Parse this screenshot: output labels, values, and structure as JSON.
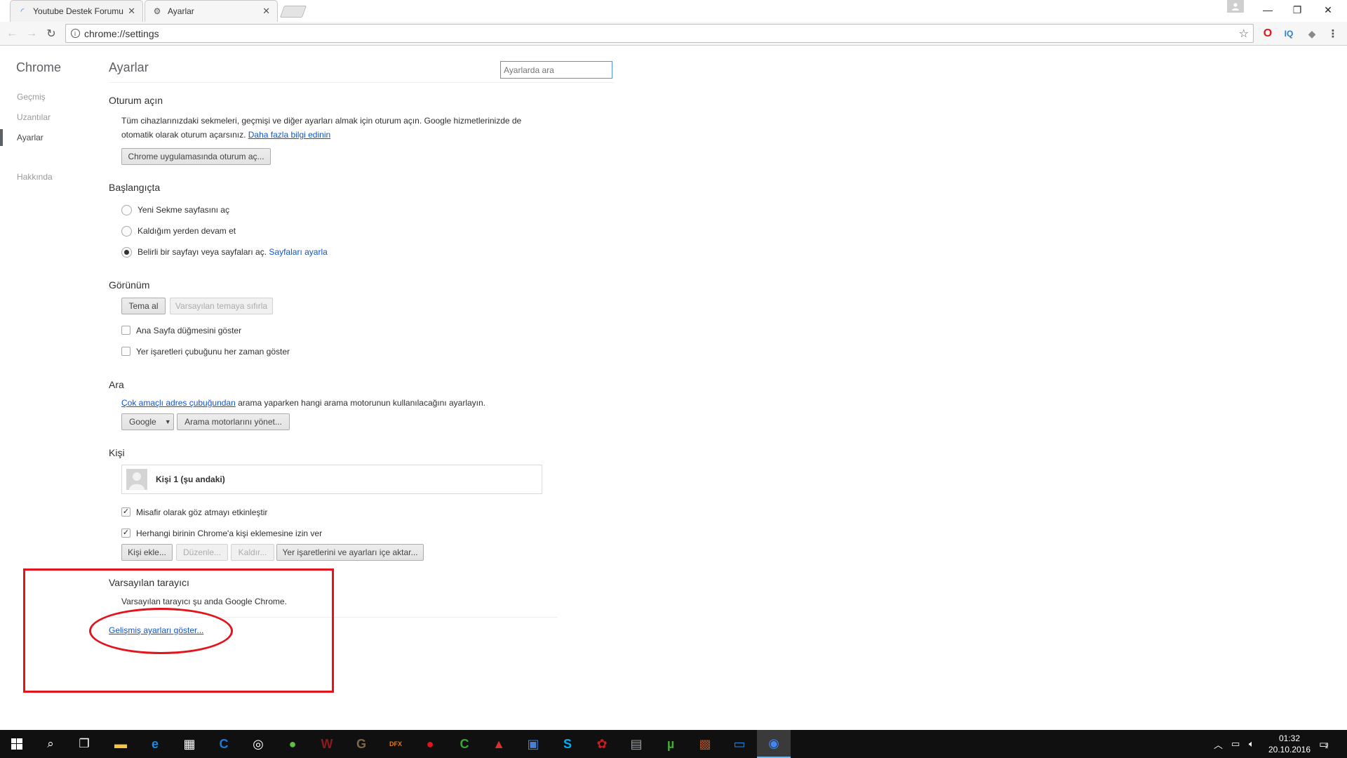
{
  "browser": {
    "tabs": [
      {
        "title": "Youtube Destek Forumu",
        "favicon": "loading-spinner-icon"
      },
      {
        "title": "Ayarlar",
        "favicon": "gear-icon"
      }
    ],
    "url": "chrome://settings",
    "extensions": [
      {
        "name": "opera-icon",
        "glyph": "O",
        "color": "#e0161b"
      },
      {
        "name": "iq-icon",
        "glyph": "IQ",
        "color": "#2a7fd4"
      },
      {
        "name": "shield-extension-icon",
        "glyph": "◆",
        "color": "#8a8a8a"
      }
    ]
  },
  "sidebar": {
    "title": "Chrome",
    "items": [
      {
        "label": "Geçmiş"
      },
      {
        "label": "Uzantılar"
      },
      {
        "label": "Ayarlar"
      },
      {
        "label": "Hakkında"
      }
    ]
  },
  "settings": {
    "title": "Ayarlar",
    "search_placeholder": "Ayarlarda ara",
    "signin": {
      "title": "Oturum açın",
      "desc_line1": "Tüm cihazlarınızdaki sekmeleri, geçmişi ve diğer ayarları almak için oturum açın. Google hizmetlerinizde de",
      "desc_line2": "otomatik olarak oturum açarsınız.",
      "learn_more": "Daha fazla bilgi edinin",
      "button": "Chrome uygulamasında oturum aç..."
    },
    "startup": {
      "title": "Başlangıçta",
      "options": [
        {
          "label": "Yeni Sekme sayfasını aç",
          "checked": false
        },
        {
          "label": "Kaldığım yerden devam et",
          "checked": false
        },
        {
          "label": "Belirli bir sayfayı veya sayfaları aç.",
          "checked": true
        }
      ],
      "set_pages_link": "Sayfaları ayarla"
    },
    "appearance": {
      "title": "Görünüm",
      "get_themes": "Tema al",
      "reset_theme": "Varsayılan temaya sıfırla",
      "checkboxes": [
        {
          "label": "Ana Sayfa düğmesini göster",
          "checked": false
        },
        {
          "label": "Yer işaretleri çubuğunu her zaman göster",
          "checked": false
        }
      ]
    },
    "search": {
      "title": "Ara",
      "omnibox_link": "Çok amaçlı adres çubuğundan",
      "desc": "arama yaparken hangi arama motorunun kullanılacağını ayarlayın.",
      "engine": "Google",
      "manage": "Arama motorlarını yönet..."
    },
    "people": {
      "title": "Kişi",
      "profile_name": "Kişi 1 (şu andaki)",
      "checkboxes": [
        {
          "label": "Misafir olarak göz atmayı etkinleştir",
          "checked": true
        },
        {
          "label": "Herhangi birinin Chrome'a kişi eklemesine izin ver",
          "checked": true
        }
      ],
      "add": "Kişi ekle...",
      "edit": "Düzenle...",
      "remove": "Kaldır...",
      "import": "Yer işaretlerini ve ayarları içe aktar..."
    },
    "default_browser": {
      "title": "Varsayılan tarayıcı",
      "desc": "Varsayılan tarayıcı şu anda Google Chrome."
    },
    "advanced_link": "Gelişmiş ayarları göster..."
  },
  "taskbar": {
    "apps": [
      {
        "name": "file-explorer-icon",
        "glyph": "▬",
        "color": "#f5c542"
      },
      {
        "name": "edge-icon",
        "glyph": "e",
        "color": "#1e88e5"
      },
      {
        "name": "store-icon",
        "glyph": "▦",
        "color": "#ffffff"
      },
      {
        "name": "ccleaner-icon",
        "glyph": "C",
        "color": "#1f7ad6"
      },
      {
        "name": "ring-app-icon",
        "glyph": "◎",
        "color": "#ffffff"
      },
      {
        "name": "globe-app-icon",
        "glyph": "●",
        "color": "#5bbf3f"
      },
      {
        "name": "winrar-icon",
        "glyph": "W",
        "color": "#8b1a1a"
      },
      {
        "name": "gimp-icon",
        "glyph": "G",
        "color": "#7a6a4a"
      },
      {
        "name": "dfx-icon",
        "glyph": "DFX",
        "color": "#e07a1b"
      },
      {
        "name": "record-icon",
        "glyph": "●",
        "color": "#e3141b"
      },
      {
        "name": "camtasia-icon",
        "glyph": "C",
        "color": "#3aa639"
      },
      {
        "name": "car-app-icon",
        "glyph": "▲",
        "color": "#d8322c"
      },
      {
        "name": "network-app-icon",
        "glyph": "▣",
        "color": "#4a7fd4"
      },
      {
        "name": "skype-icon",
        "glyph": "S",
        "color": "#00aff0"
      },
      {
        "name": "pinwheel-app-icon",
        "glyph": "✿",
        "color": "#c81e1e"
      },
      {
        "name": "tools-app-icon",
        "glyph": "▤",
        "color": "#9aa0a6"
      },
      {
        "name": "utorrent-icon",
        "glyph": "µ",
        "color": "#3fae2a"
      },
      {
        "name": "game-app-icon",
        "glyph": "▩",
        "color": "#a0522d"
      },
      {
        "name": "window-app-icon",
        "glyph": "▭",
        "color": "#1e88e5"
      },
      {
        "name": "chrome-icon",
        "glyph": "◉",
        "color": "#4285f4"
      }
    ],
    "time": "01:32",
    "date": "20.10.2016",
    "notification_count": "1"
  }
}
